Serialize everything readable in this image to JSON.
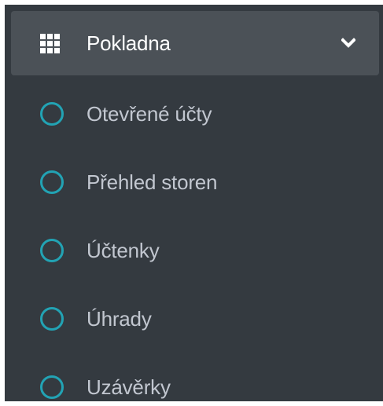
{
  "sidebar": {
    "section": {
      "label": "Pokladna",
      "icon": "grid-icon",
      "expand_icon": "chevron-down-icon"
    },
    "items": [
      {
        "label": "Otevřené účty",
        "icon": "circle-icon"
      },
      {
        "label": "Přehled storen",
        "icon": "circle-icon"
      },
      {
        "label": "Účtenky",
        "icon": "circle-icon"
      },
      {
        "label": "Úhrady",
        "icon": "circle-icon"
      },
      {
        "label": "Uzávěrky",
        "icon": "circle-icon"
      }
    ]
  },
  "colors": {
    "sidebar_bg": "#343a40",
    "header_bg": "#4b5157",
    "item_text": "#c2c7d0",
    "header_text": "#ffffff",
    "circle_accent": "#22a3b4"
  }
}
